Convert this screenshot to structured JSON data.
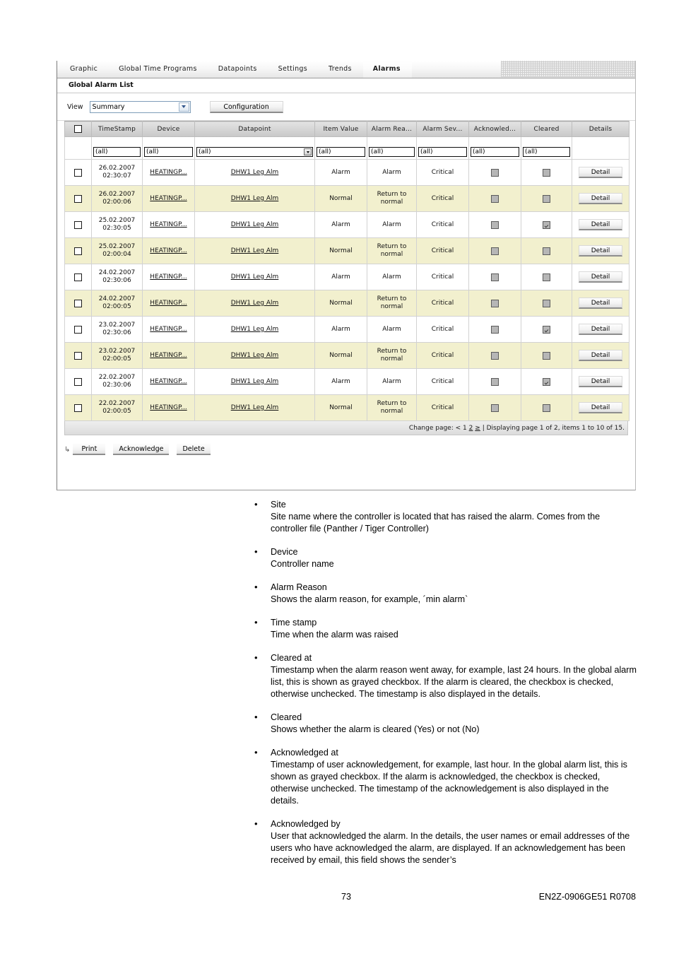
{
  "app": {
    "tabs": [
      {
        "label": "Graphic",
        "active": false
      },
      {
        "label": "Global Time Programs",
        "active": false
      },
      {
        "label": "Datapoints",
        "active": false
      },
      {
        "label": "Settings",
        "active": false
      },
      {
        "label": "Trends",
        "active": false
      },
      {
        "label": "Alarms",
        "active": true
      }
    ],
    "section_title": "Global Alarm List",
    "toolbar": {
      "view_label": "View",
      "view_value": "Summary",
      "configuration_label": "Configuration"
    },
    "grid": {
      "columns": [
        "",
        "TimeStamp",
        "Device",
        "Datapoint",
        "Item Value",
        "Alarm Rea...",
        "Alarm Sev...",
        "Acknowled...",
        "Cleared",
        "Details"
      ],
      "filters": {
        "timestamp": "(all)",
        "device": "(all)",
        "datapoint": "(all)",
        "item_value": "(all)",
        "alarm_reason": "(all)",
        "alarm_severity": "(all)",
        "acknowledged": "(all)",
        "cleared": "(all)"
      },
      "detail_label": "Detail",
      "rows": [
        {
          "date": "26.02.2007",
          "time": "02:30:07",
          "device": "HEATINGP...",
          "datapoint": "DHW1 Leg Alm",
          "item_value": "Alarm",
          "alarm_reason": "Alarm",
          "severity": "Critical",
          "acknowledged": false,
          "cleared": false
        },
        {
          "date": "26.02.2007",
          "time": "02:00:06",
          "device": "HEATINGP...",
          "datapoint": "DHW1 Leg Alm",
          "item_value": "Normal",
          "alarm_reason": "Return to normal",
          "severity": "Critical",
          "acknowledged": false,
          "cleared": false
        },
        {
          "date": "25.02.2007",
          "time": "02:30:05",
          "device": "HEATINGP...",
          "datapoint": "DHW1 Leg Alm",
          "item_value": "Alarm",
          "alarm_reason": "Alarm",
          "severity": "Critical",
          "acknowledged": false,
          "cleared": true
        },
        {
          "date": "25.02.2007",
          "time": "02:00:04",
          "device": "HEATINGP...",
          "datapoint": "DHW1 Leg Alm",
          "item_value": "Normal",
          "alarm_reason": "Return to normal",
          "severity": "Critical",
          "acknowledged": false,
          "cleared": false
        },
        {
          "date": "24.02.2007",
          "time": "02:30:06",
          "device": "HEATINGP...",
          "datapoint": "DHW1 Leg Alm",
          "item_value": "Alarm",
          "alarm_reason": "Alarm",
          "severity": "Critical",
          "acknowledged": false,
          "cleared": false
        },
        {
          "date": "24.02.2007",
          "time": "02:00:05",
          "device": "HEATINGP...",
          "datapoint": "DHW1 Leg Alm",
          "item_value": "Normal",
          "alarm_reason": "Return to normal",
          "severity": "Critical",
          "acknowledged": false,
          "cleared": false
        },
        {
          "date": "23.02.2007",
          "time": "02:30:06",
          "device": "HEATINGP...",
          "datapoint": "DHW1 Leg Alm",
          "item_value": "Alarm",
          "alarm_reason": "Alarm",
          "severity": "Critical",
          "acknowledged": false,
          "cleared": true
        },
        {
          "date": "23.02.2007",
          "time": "02:00:05",
          "device": "HEATINGP...",
          "datapoint": "DHW1 Leg Alm",
          "item_value": "Normal",
          "alarm_reason": "Return to normal",
          "severity": "Critical",
          "acknowledged": false,
          "cleared": false
        },
        {
          "date": "22.02.2007",
          "time": "02:30:06",
          "device": "HEATINGP...",
          "datapoint": "DHW1 Leg Alm",
          "item_value": "Alarm",
          "alarm_reason": "Alarm",
          "severity": "Critical",
          "acknowledged": false,
          "cleared": true
        },
        {
          "date": "22.02.2007",
          "time": "02:00:05",
          "device": "HEATINGP...",
          "datapoint": "DHW1 Leg Alm",
          "item_value": "Normal",
          "alarm_reason": "Return to normal",
          "severity": "Critical",
          "acknowledged": false,
          "cleared": false
        }
      ]
    },
    "pager": {
      "change_page_label": "Change page:",
      "prev": "<",
      "page_1": "1",
      "page_2": "2",
      "next": "≥",
      "separator": "|",
      "status": "Displaying page 1 of 2, items 1 to 10 of 15."
    },
    "actions": {
      "print": "Print",
      "acknowledge": "Acknowledge",
      "delete": "Delete"
    }
  },
  "doc": {
    "items": [
      {
        "term": "Site",
        "desc": "Site name where the controller is located that has raised the alarm. Comes from the controller file (Panther / Tiger Controller)"
      },
      {
        "term": "Device",
        "desc": "Controller name"
      },
      {
        "term": "Alarm Reason",
        "desc": "Shows the alarm reason, for example, ´min alarm`"
      },
      {
        "term": "Time stamp",
        "desc": "Time when the alarm was raised"
      },
      {
        "term": "Cleared at",
        "desc": "Timestamp when the alarm reason went away, for example, last 24 hours. In the global alarm list, this is shown as grayed checkbox. If the alarm is cleared, the checkbox is checked, otherwise unchecked. The timestamp is also displayed in the details."
      },
      {
        "term": "Cleared",
        "desc": "Shows whether the alarm is cleared (Yes) or not (No)"
      },
      {
        "term": "Acknowledged at",
        "desc": "Timestamp of user acknowledgement, for example, last hour. In the global alarm list, this is shown as grayed checkbox. If the alarm is acknowledged, the checkbox is checked, otherwise unchecked. The timestamp of the acknowledgement is also displayed in the details."
      },
      {
        "term": "Acknowledged by",
        "desc": "User that acknowledged the alarm. In the details, the user names or email addresses of the users who have acknowledged the alarm, are displayed. If an acknowledgement has been received by email, this field shows the sender’s"
      }
    ]
  },
  "footer": {
    "page_number": "73",
    "document_id": "EN2Z-0906GE51 R0708"
  }
}
